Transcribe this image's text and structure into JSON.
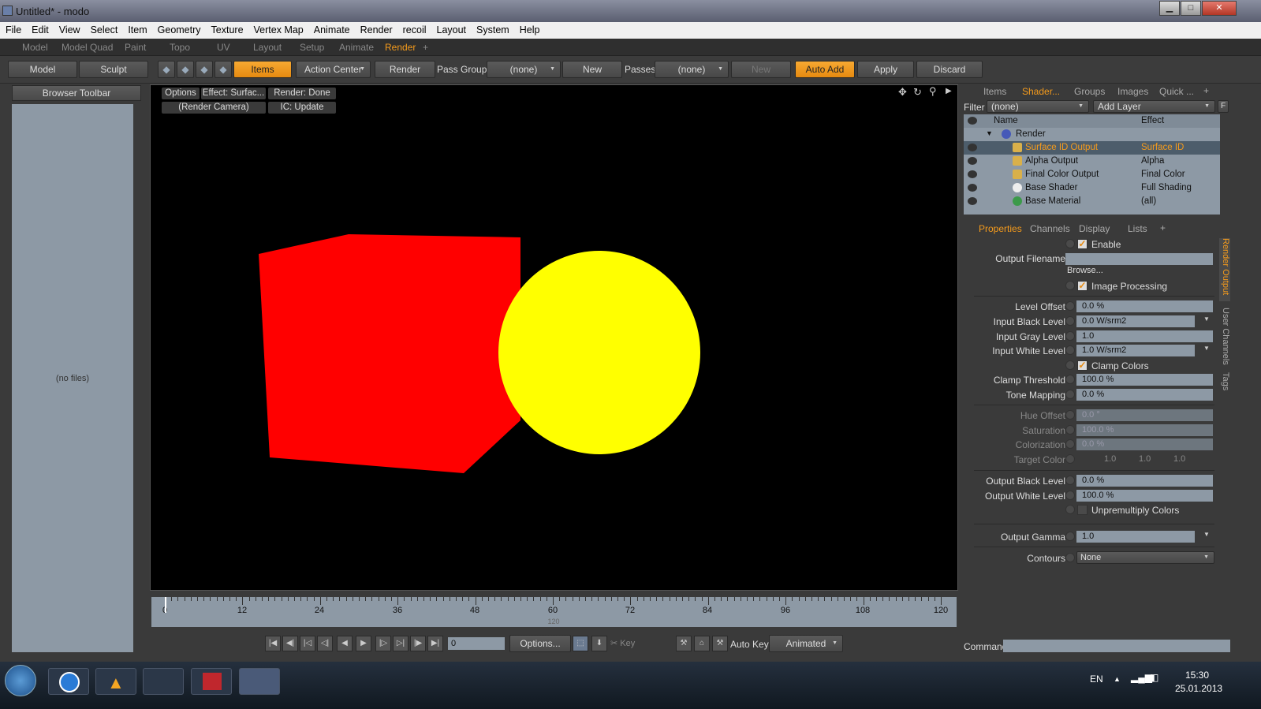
{
  "window": {
    "title": "Untitled* - modo",
    "minimize": "▁",
    "maximize": "□",
    "close": "✕"
  },
  "menu": [
    "File",
    "Edit",
    "View",
    "Select",
    "Item",
    "Geometry",
    "Texture",
    "Vertex Map",
    "Animate",
    "Render",
    "recoil",
    "Layout",
    "System",
    "Help"
  ],
  "layout_tabs": [
    "Model",
    "Model Quad",
    "Paint",
    "Topo",
    "UV",
    "Layout",
    "Setup",
    "Animate",
    "Render",
    "+"
  ],
  "active_layout_tab": "Render",
  "toolbar": {
    "model": "Model",
    "sculpt": "Sculpt",
    "items": "Items",
    "action_center": "Action Center",
    "render": "Render",
    "pass_groups_label": "Pass Groups",
    "pass_groups_value": "(none)",
    "new1": "New",
    "passes_label": "Passes",
    "passes_value": "(none)",
    "new2": "New",
    "auto_add": "Auto Add",
    "apply": "Apply",
    "discard": "Discard"
  },
  "browser": {
    "toolbar": "Browser Toolbar",
    "empty": "(no files)"
  },
  "viewport": {
    "options": "Options",
    "effect": "Effect: Surfac...",
    "render_status": "Render: Done",
    "camera": "(Render Camera)",
    "ic": "IC: Update",
    "cube_color": "#ff0000",
    "sphere_color": "#ffff00"
  },
  "timeline": {
    "ticks": [
      "0",
      "12",
      "24",
      "36",
      "48",
      "60",
      "72",
      "84",
      "96",
      "108",
      "120"
    ],
    "end_marker": "120"
  },
  "transport": {
    "frame": "0",
    "options": "Options...",
    "key": "Key",
    "auto_key": "Auto Key",
    "animated": "Animated"
  },
  "right_tabs": [
    "Items",
    "Shader...",
    "Groups",
    "Images",
    "Quick ...",
    "+"
  ],
  "filter": {
    "label": "Filter",
    "value": "(none)",
    "add_layer": "Add Layer",
    "f": "F"
  },
  "shader_tree": {
    "headers": {
      "name": "Name",
      "effect": "Effect"
    },
    "rows": [
      {
        "name": "Render",
        "effect": ""
      },
      {
        "name": "Surface ID Output",
        "effect": "Surface ID"
      },
      {
        "name": "Alpha Output",
        "effect": "Alpha"
      },
      {
        "name": "Final Color Output",
        "effect": "Final Color"
      },
      {
        "name": "Base Shader",
        "effect": "Full Shading"
      },
      {
        "name": "Base Material",
        "effect": "(all)"
      }
    ]
  },
  "props_tabs": [
    "Properties",
    "Channels",
    "Display",
    "Lists",
    "+"
  ],
  "side_tabs": [
    "Render Output",
    "User Channels",
    "Tags"
  ],
  "properties": {
    "enable": "Enable",
    "output_filename": "Output Filename",
    "browse": "Browse...",
    "image_processing": "Image Processing",
    "level_offset": {
      "label": "Level Offset",
      "value": "0.0 %"
    },
    "input_black": {
      "label": "Input Black Level",
      "value": "0.0 W/srm2"
    },
    "input_gray": {
      "label": "Input Gray Level",
      "value": "1.0"
    },
    "input_white": {
      "label": "Input White Level",
      "value": "1.0 W/srm2"
    },
    "clamp_colors": "Clamp Colors",
    "clamp_threshold": {
      "label": "Clamp Threshold",
      "value": "100.0 %"
    },
    "tone_mapping": {
      "label": "Tone Mapping",
      "value": "0.0 %"
    },
    "hue_offset": {
      "label": "Hue Offset",
      "value": "0.0 °"
    },
    "saturation": {
      "label": "Saturation",
      "value": "100.0 %"
    },
    "colorization": {
      "label": "Colorization",
      "value": "0.0 %"
    },
    "target_color": {
      "label": "Target Color",
      "r": "1.0",
      "g": "1.0",
      "b": "1.0"
    },
    "output_black": {
      "label": "Output Black Level",
      "value": "0.0 %"
    },
    "output_white": {
      "label": "Output White Level",
      "value": "100.0 %"
    },
    "unpremultiply": "Unpremultiply Colors",
    "output_gamma": {
      "label": "Output Gamma",
      "value": "1.0"
    },
    "contours": {
      "label": "Contours",
      "value": "None"
    }
  },
  "command": {
    "label": "Command"
  },
  "taskbar": {
    "lang": "EN",
    "time": "15:30",
    "date": "25.01.2013"
  }
}
